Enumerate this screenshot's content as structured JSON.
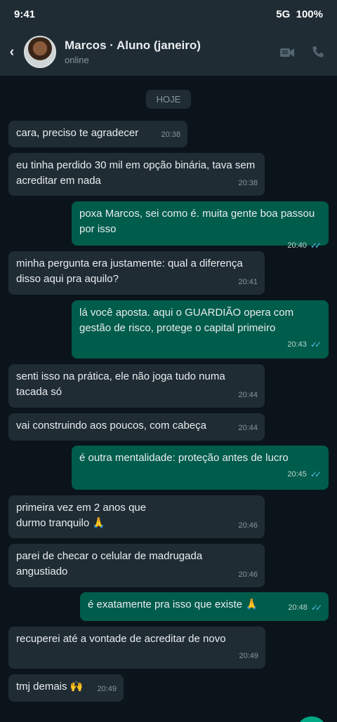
{
  "status_bar": {
    "time": "9:41",
    "network": "5G",
    "battery": "100%"
  },
  "header": {
    "back_icon": "chevron-left-icon",
    "name": "Marcos · Aluno (janeiro)",
    "status": "online",
    "icons": [
      "video-call-icon",
      "phone-icon"
    ]
  },
  "chat": {
    "day_label": "HOJE",
    "tick_glyph": "✓✓",
    "messages": [
      {
        "dir": "in",
        "text": "cara, preciso te agradecer",
        "time": "20:38"
      },
      {
        "dir": "in",
        "text": "eu tinha perdido 30 mil em opção binária, tava sem acreditar em nada",
        "time": "20:38"
      },
      {
        "dir": "out",
        "text": "poxa Marcos, sei como é. muita gente boa passou por isso",
        "time": "20:40",
        "read": true
      },
      {
        "dir": "in",
        "text": "minha pergunta era justamente: qual a diferença disso aqui pra aquilo?",
        "time": "20:41"
      },
      {
        "dir": "out",
        "text": "lá você aposta. aqui o GUARDIÃO opera com gestão de risco, protege o capital primeiro",
        "time": "20:43",
        "read": true
      },
      {
        "dir": "in",
        "text": "senti isso na prática, ele não joga tudo numa tacada só",
        "time": "20:44"
      },
      {
        "dir": "in",
        "text": "vai construindo aos poucos, com cabeça",
        "time": "20:44"
      },
      {
        "dir": "out",
        "text": "é outra mentalidade: proteção antes de lucro",
        "time": "20:45",
        "read": true
      },
      {
        "dir": "in",
        "text": "primeira vez em 2 anos que durmo tranquilo 🙏",
        "time": "20:46"
      },
      {
        "dir": "in",
        "text": "parei de checar o celular de madrugada angustiado",
        "time": "20:46"
      },
      {
        "dir": "out",
        "text": "é exatamente pra isso que existe 🙏",
        "time": "20:48",
        "read": true
      },
      {
        "dir": "in",
        "text": "recuperei até a vontade de acreditar de novo",
        "time": "20:49"
      },
      {
        "dir": "in",
        "text": "tmj demais 🙌",
        "time": "20:49"
      }
    ]
  },
  "colors": {
    "background": "#0b141a",
    "incoming_bubble": "#1f2c34",
    "outgoing_bubble": "#005c4b",
    "read_ticks": "#53bdeb",
    "fab": "#00a884"
  }
}
